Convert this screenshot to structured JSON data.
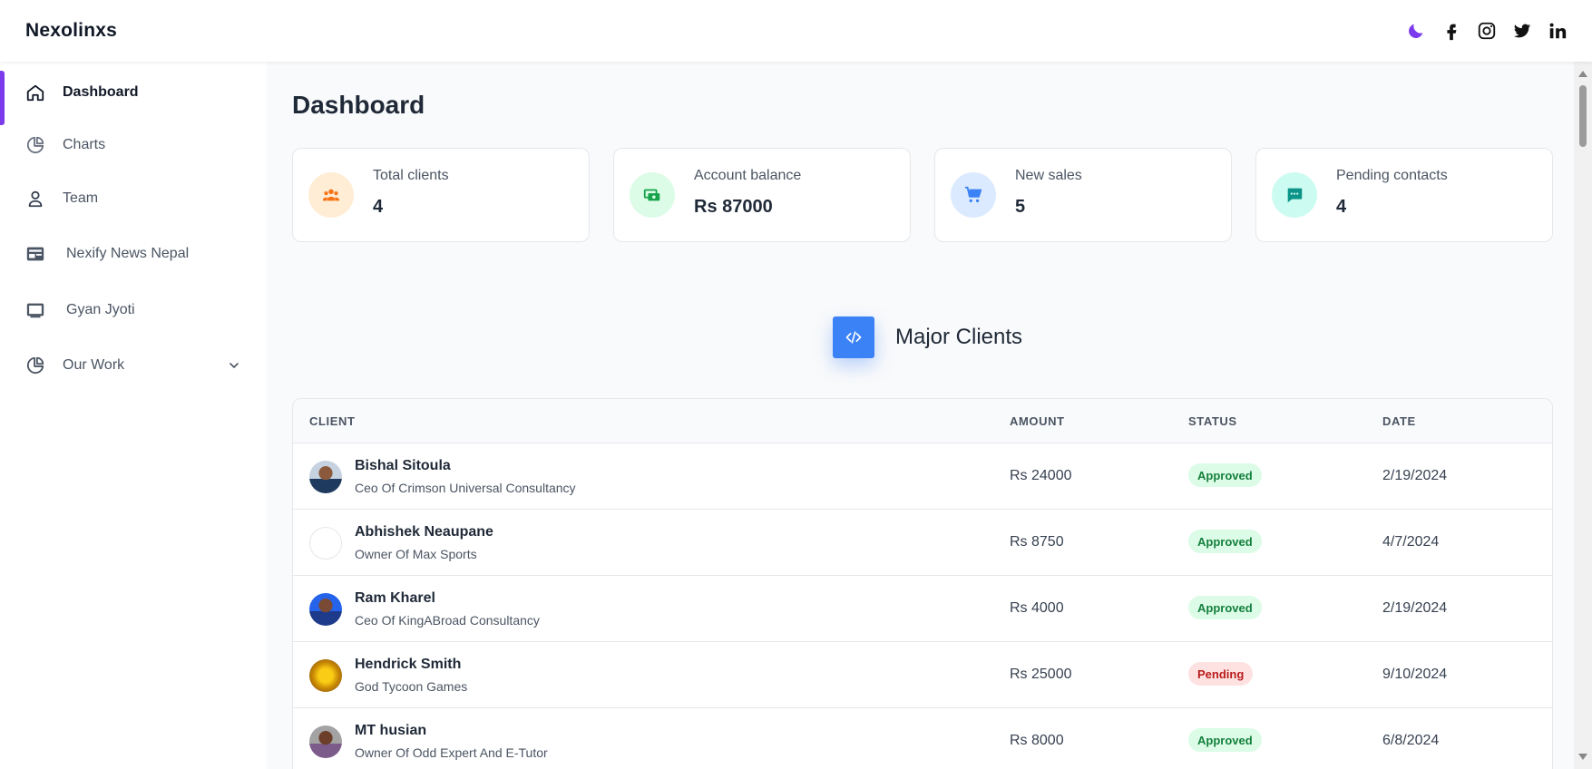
{
  "app": {
    "brand": "Nexolinxs"
  },
  "header": {
    "icons": [
      "moon-icon",
      "facebook-icon",
      "instagram-icon",
      "twitter-icon",
      "linkedin-icon"
    ]
  },
  "sidebar": {
    "accent_color": "#7c3aed",
    "items": [
      {
        "label": "Dashboard",
        "icon": "home-icon",
        "active": true
      },
      {
        "label": "Charts",
        "icon": "pie-chart-icon"
      },
      {
        "label": "Team",
        "icon": "user-icon"
      },
      {
        "label": "Nexify News Nepal",
        "icon": "newspaper-icon"
      },
      {
        "label": "Gyan Jyoti",
        "icon": "monitor-icon"
      },
      {
        "label": "Our Work",
        "icon": "pie-chart-icon",
        "expandable": true
      }
    ]
  },
  "main": {
    "title": "Dashboard",
    "cards": [
      {
        "label": "Total clients",
        "value": "4",
        "icon": "people-icon",
        "color": "#f97316",
        "bg": "#ffedd5"
      },
      {
        "label": "Account balance",
        "value": "Rs 87000",
        "icon": "money-icon",
        "color": "#16a34a",
        "bg": "#dcfce7"
      },
      {
        "label": "New sales",
        "value": "5",
        "icon": "cart-icon",
        "color": "#3b82f6",
        "bg": "#dbeafe"
      },
      {
        "label": "Pending contacts",
        "value": "4",
        "icon": "chat-icon",
        "color": "#0d9488",
        "bg": "#ccfbf1"
      }
    ],
    "section": {
      "title": "Major Clients",
      "icon": "code-icon"
    },
    "table": {
      "headers": {
        "client": "CLIENT",
        "amount": "AMOUNT",
        "status": "STATUS",
        "date": "DATE"
      },
      "rows": [
        {
          "name": "Bishal Sitoula",
          "role": "Ceo Of Crimson Universal Consultancy",
          "amount": "Rs 24000",
          "status": "Approved",
          "date": "2/19/2024"
        },
        {
          "name": "Abhishek Neaupane",
          "role": "Owner Of Max Sports",
          "amount": "Rs 8750",
          "status": "Approved",
          "date": "4/7/2024"
        },
        {
          "name": "Ram Kharel",
          "role": "Ceo Of KingABroad Consultancy",
          "amount": "Rs 4000",
          "status": "Approved",
          "date": "2/19/2024"
        },
        {
          "name": "Hendrick Smith",
          "role": "God Tycoon Games",
          "amount": "Rs 25000",
          "status": "Pending",
          "date": "9/10/2024"
        },
        {
          "name": "MT husian",
          "role": "Owner Of Odd Expert And E-Tutor",
          "amount": "Rs 8000",
          "status": "Approved",
          "date": "6/8/2024"
        }
      ]
    }
  }
}
